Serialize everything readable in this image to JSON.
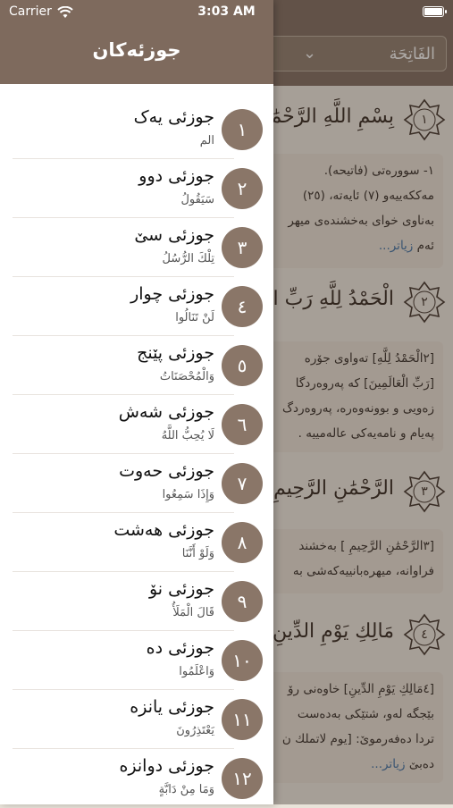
{
  "status_bar": {
    "carrier": "Carrier",
    "time": "3:03 AM"
  },
  "background": {
    "sura_selector": {
      "label": "الفَاتِحَة"
    },
    "ayahs": [
      {
        "number": "١",
        "text": "بِسْمِ اللَّهِ الرَّحْمَٰنِ الرَّ"
      },
      {
        "number": "٢",
        "text": "الْحَمْدُ لِلَّهِ رَبِّ الْعَا"
      },
      {
        "number": "٣",
        "text": "الرَّحْمَٰنِ الرَّحِيمِ"
      },
      {
        "number": "٤",
        "text": "مَالِكِ يَوْمِ الدِّينِ"
      }
    ],
    "tafsir_blocks": [
      {
        "lines": [
          "١- سوورەتی (فاتیحە).",
          "مەککەییەو (٧) ئایەتە، (٢٥)",
          "بەناوی خوای بەخشندەی میهر",
          "ئەم"
        ],
        "more": "زیاتر..."
      },
      {
        "lines": [
          "[٢الْحَمْدُ لِلَّهِ] تەواوی جۆرە",
          "[رَبِّ الْعَالَمِينَ] كە پەروەردگا",
          "زەویی و بوونەوەرە، پەروەردگ",
          "پەیام و نامەیەکی عالەمییە ."
        ],
        "more": ""
      },
      {
        "lines": [
          "[٣الرَّحْمَٰنِ الرَّحِيمِ ] بەخشند",
          "فراوانە، میهرەبانییەکەشی بە"
        ],
        "more": ""
      },
      {
        "lines": [
          "[٤مَالِكِ يَوْمِ الدِّينِ] خاوەنی رۆ",
          "بێجگە لەو، شتێکی بەدەست",
          "تردا دەفەرموێ: [يوم لاتملك ن",
          "دەبێ"
        ],
        "more": "زیاتر..."
      }
    ]
  },
  "drawer": {
    "title": "جوزئەکان",
    "items": [
      {
        "number": "١",
        "title": "جوزئی یەک",
        "subtitle": "الم"
      },
      {
        "number": "٢",
        "title": "جوزئی دوو",
        "subtitle": "سَيَقُولُ"
      },
      {
        "number": "٣",
        "title": "جوزئی سێ",
        "subtitle": "تِلْكَ الرُّسُلُ"
      },
      {
        "number": "٤",
        "title": "جوزئی چوار",
        "subtitle": "لَنْ تَنَالُوا"
      },
      {
        "number": "٥",
        "title": "جوزئی پێنج",
        "subtitle": "وَالْمُحْصَنَاتُ"
      },
      {
        "number": "٦",
        "title": "جوزئی شەش",
        "subtitle": "لَا يُحِبُّ اللَّهُ"
      },
      {
        "number": "٧",
        "title": "جوزئی حەوت",
        "subtitle": "وَإِذَا سَمِعُوا"
      },
      {
        "number": "٨",
        "title": "جوزئی هەشت",
        "subtitle": "وَلَوْ أَنَّنَا"
      },
      {
        "number": "٩",
        "title": "جوزئی نۆ",
        "subtitle": "قَالَ الْمَلَأُ"
      },
      {
        "number": "١٠",
        "title": "جوزئی دە",
        "subtitle": "وَاعْلَمُوا"
      },
      {
        "number": "١١",
        "title": "جوزئی یانزە",
        "subtitle": "يَعْتَذِرُونَ"
      },
      {
        "number": "١٢",
        "title": "جوزئی دوانزە",
        "subtitle": "وَمَا مِنْ دَابَّةٍ"
      }
    ]
  },
  "colors": {
    "brand": "#7e6a5d",
    "badge": "#8a7668",
    "link": "#3a6ea5"
  }
}
